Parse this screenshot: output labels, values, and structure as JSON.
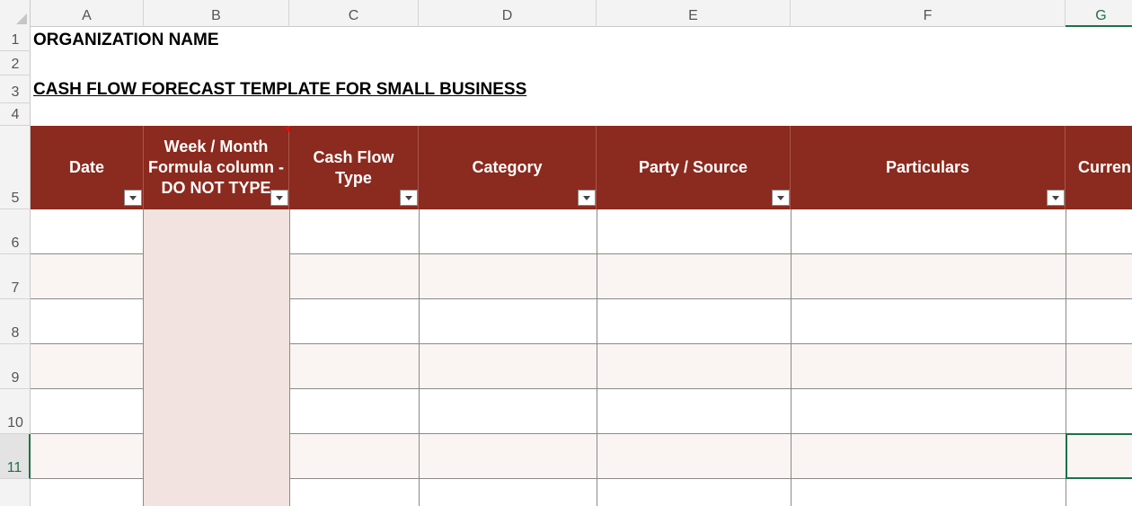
{
  "columns": [
    "A",
    "B",
    "C",
    "D",
    "E",
    "F",
    "G"
  ],
  "rows": [
    "1",
    "2",
    "3",
    "4",
    "5",
    "6",
    "7",
    "8",
    "9",
    "10",
    "11"
  ],
  "title": "ORGANIZATION NAME",
  "subtitle": "CASH FLOW FORECAST TEMPLATE FOR SMALL BUSINESS",
  "headers": {
    "date": "Date",
    "week_month": "Week / Month Formula column - DO NOT TYPE",
    "cash_flow_type": "Cash Flow Type",
    "category": "Category",
    "party_source": "Party / Source",
    "particulars": "Particulars",
    "currency": "Curren"
  },
  "colors": {
    "header_band": "#8b2a1e",
    "formula_column": "#f2e3e0",
    "alt_row": "#faf5f2",
    "selection": "#1e7145"
  },
  "selected_cell": "G11"
}
